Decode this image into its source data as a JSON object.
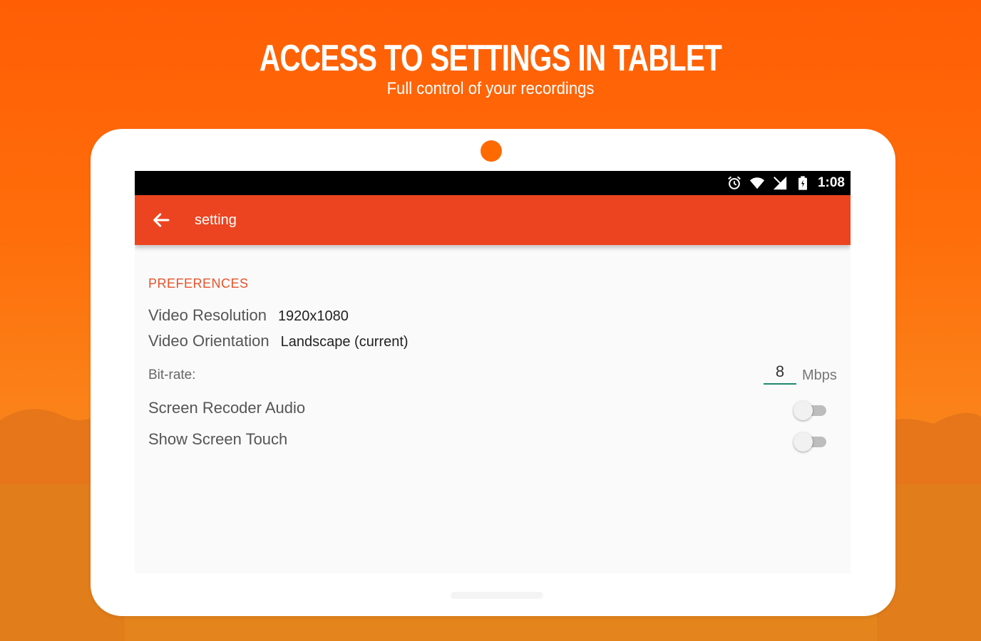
{
  "promo": {
    "headline": "ACCESS TO SETTINGS IN TABLET",
    "subheadline": "Full control of your recordings"
  },
  "status_bar": {
    "time": "1:08",
    "icons": [
      "alarm-icon",
      "wifi-icon",
      "signal-icon",
      "battery-icon"
    ]
  },
  "app_bar": {
    "title": "setting",
    "back_icon": "arrow-back-icon"
  },
  "preferences": {
    "section_header": "PREFERENCES",
    "video_resolution": {
      "label": "Video Resolution",
      "value": "1920x1080"
    },
    "video_orientation": {
      "label": "Video Orientation",
      "value": "Landscape (current)"
    },
    "bitrate": {
      "label": "Bit-rate:",
      "value": "8",
      "unit": "Mbps"
    },
    "screen_recorder_audio": {
      "label": "Screen Recoder Audio",
      "enabled": false
    },
    "show_screen_touch": {
      "label": "Show Screen Touch",
      "enabled": false
    }
  },
  "colors": {
    "background_orange": "#ff6a00",
    "app_bar": "#ec4420",
    "section_header": "#e8532a",
    "input_underline": "#1f8a70",
    "camera_dot": "#ff6a00"
  }
}
